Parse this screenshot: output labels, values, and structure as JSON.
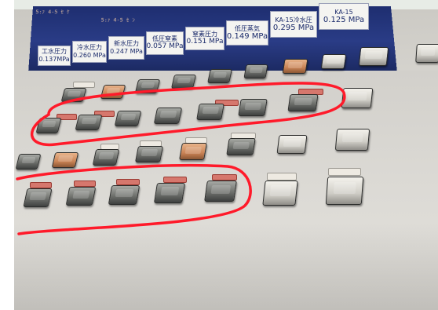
{
  "screen": {
    "rows": [
      "5:ｧ 4-5 ｾ ｹ",
      "5:ｧ 4-5 ｾ ﾝ"
    ],
    "gauges": [
      {
        "label": "工水圧力",
        "value": "0.137MPa"
      },
      {
        "label": "冷水圧力",
        "value": "0.260 MPa"
      },
      {
        "label": "新水圧力",
        "value": "0.247 MPa"
      },
      {
        "label": "低圧窒素",
        "value": "0.057 MPa"
      },
      {
        "label": "窒素圧力",
        "value": "0.151 MPa"
      },
      {
        "label": "低圧蒸気",
        "value": "0.149 MPa"
      },
      {
        "label": "KA-15冷水圧",
        "value": "0.295 MPa"
      },
      {
        "label": "KA-15",
        "value": "0.125 MPa"
      }
    ]
  },
  "colors": {
    "annotation_red": "#ff1a2a",
    "screen_blue": "#22347c",
    "panel_grey": "#d8d6d1"
  }
}
